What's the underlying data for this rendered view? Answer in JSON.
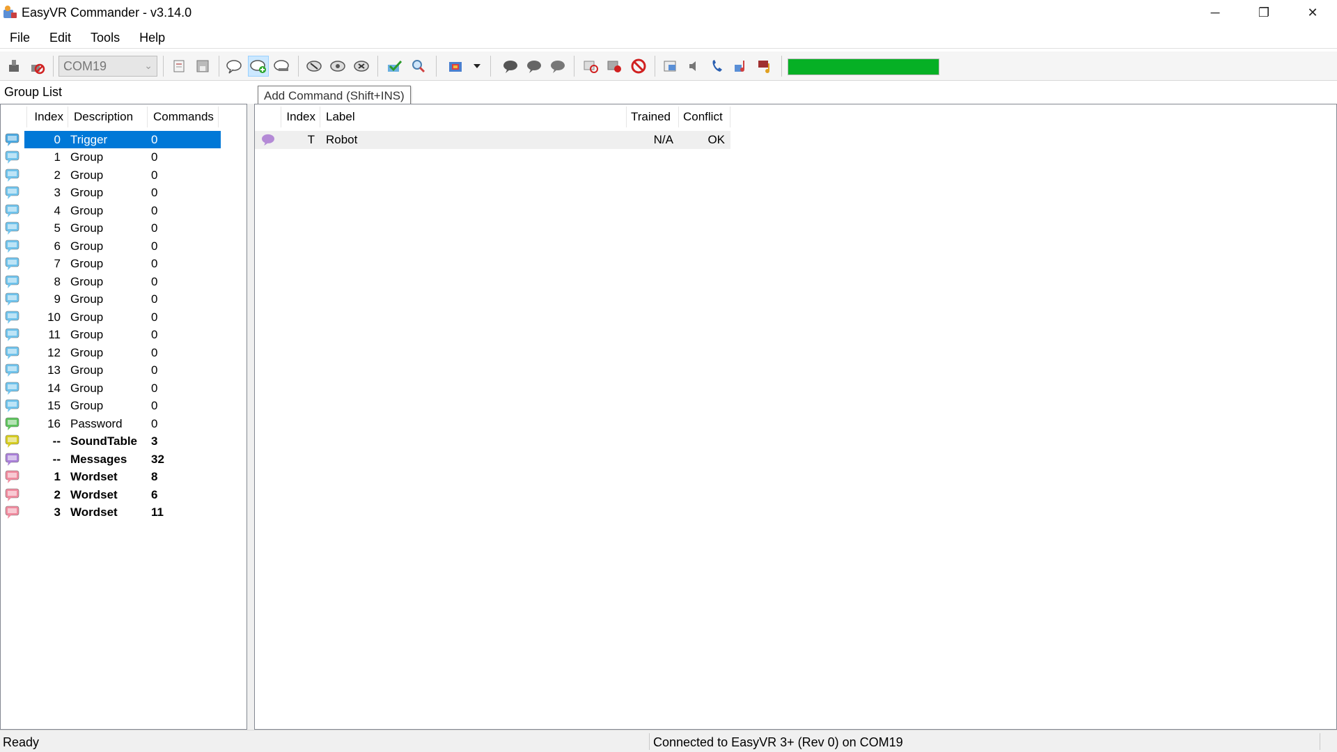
{
  "window": {
    "title": "EasyVR Commander - v3.14.0",
    "minimize_glyph": "─",
    "maximize_glyph": "❐",
    "close_glyph": "✕"
  },
  "menu": [
    "File",
    "Edit",
    "Tools",
    "Help"
  ],
  "toolbar": {
    "com_port": "COM19",
    "progress_percent": 100,
    "progress_color": "#06b025",
    "tooltip": "Add Command (Shift+INS)"
  },
  "group_list": {
    "label": "Group List",
    "headers": {
      "index": "Index",
      "description": "Description",
      "commands": "Commands"
    },
    "rows": [
      {
        "index": "0",
        "description": "Trigger",
        "commands": "0",
        "icon": "trigger-bubble-icon",
        "color": "#4aa8e0",
        "bold": false,
        "selected": true
      },
      {
        "index": "1",
        "description": "Group",
        "commands": "0",
        "icon": "group-bubble-icon",
        "color": "#6fc3ec",
        "bold": false
      },
      {
        "index": "2",
        "description": "Group",
        "commands": "0",
        "icon": "group-bubble-icon",
        "color": "#6fc3ec",
        "bold": false
      },
      {
        "index": "3",
        "description": "Group",
        "commands": "0",
        "icon": "group-bubble-icon",
        "color": "#6fc3ec",
        "bold": false
      },
      {
        "index": "4",
        "description": "Group",
        "commands": "0",
        "icon": "group-bubble-icon",
        "color": "#6fc3ec",
        "bold": false
      },
      {
        "index": "5",
        "description": "Group",
        "commands": "0",
        "icon": "group-bubble-icon",
        "color": "#6fc3ec",
        "bold": false
      },
      {
        "index": "6",
        "description": "Group",
        "commands": "0",
        "icon": "group-bubble-icon",
        "color": "#6fc3ec",
        "bold": false
      },
      {
        "index": "7",
        "description": "Group",
        "commands": "0",
        "icon": "group-bubble-icon",
        "color": "#6fc3ec",
        "bold": false
      },
      {
        "index": "8",
        "description": "Group",
        "commands": "0",
        "icon": "group-bubble-icon",
        "color": "#6fc3ec",
        "bold": false
      },
      {
        "index": "9",
        "description": "Group",
        "commands": "0",
        "icon": "group-bubble-icon",
        "color": "#6fc3ec",
        "bold": false
      },
      {
        "index": "10",
        "description": "Group",
        "commands": "0",
        "icon": "group-bubble-icon",
        "color": "#6fc3ec",
        "bold": false
      },
      {
        "index": "11",
        "description": "Group",
        "commands": "0",
        "icon": "group-bubble-icon",
        "color": "#6fc3ec",
        "bold": false
      },
      {
        "index": "12",
        "description": "Group",
        "commands": "0",
        "icon": "group-bubble-icon",
        "color": "#6fc3ec",
        "bold": false
      },
      {
        "index": "13",
        "description": "Group",
        "commands": "0",
        "icon": "group-bubble-icon",
        "color": "#6fc3ec",
        "bold": false
      },
      {
        "index": "14",
        "description": "Group",
        "commands": "0",
        "icon": "group-bubble-icon",
        "color": "#6fc3ec",
        "bold": false
      },
      {
        "index": "15",
        "description": "Group",
        "commands": "0",
        "icon": "group-bubble-icon",
        "color": "#6fc3ec",
        "bold": false
      },
      {
        "index": "16",
        "description": "Password",
        "commands": "0",
        "icon": "password-bubble-icon",
        "color": "#5cc25c",
        "bold": false
      },
      {
        "index": "--",
        "description": "SoundTable",
        "commands": "3",
        "icon": "soundtable-bubble-icon",
        "color": "#d6cc1e",
        "bold": true
      },
      {
        "index": "--",
        "description": "Messages",
        "commands": "32",
        "icon": "messages-bubble-icon",
        "color": "#a97fd8",
        "bold": true
      },
      {
        "index": "1",
        "description": "Wordset",
        "commands": "8",
        "icon": "wordset-bubble-icon",
        "color": "#f08a9e",
        "bold": true
      },
      {
        "index": "2",
        "description": "Wordset",
        "commands": "6",
        "icon": "wordset-bubble-icon",
        "color": "#f08a9e",
        "bold": true
      },
      {
        "index": "3",
        "description": "Wordset",
        "commands": "11",
        "icon": "wordset-bubble-icon",
        "color": "#f08a9e",
        "bold": true
      }
    ]
  },
  "commands": {
    "headers": {
      "index": "Index",
      "label": "Label",
      "trained": "Trained",
      "conflict": "Conflict"
    },
    "rows": [
      {
        "index": "T",
        "label": "Robot",
        "trained": "N/A",
        "conflict": "OK",
        "icon": "command-bubble-icon",
        "color": "#b48ad6"
      }
    ]
  },
  "status": {
    "left": "Ready",
    "right": "Connected to EasyVR 3+ (Rev 0) on COM19"
  }
}
